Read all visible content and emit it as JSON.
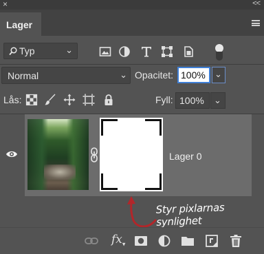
{
  "window": {
    "close_glyph": "×",
    "collapse_glyph": "<<"
  },
  "panel": {
    "tab_label": "Lager",
    "menu_icon": "panel-menu-icon"
  },
  "filter": {
    "kind_label": "Typ",
    "icons": [
      "image-filter-icon",
      "adjustment-filter-icon",
      "type-filter-icon",
      "shape-filter-icon",
      "smart-object-filter-icon"
    ]
  },
  "blend": {
    "mode": "Normal",
    "opacity_label": "Opacitet:",
    "opacity_value": "100%"
  },
  "lock": {
    "label": "Lås:",
    "icons": [
      "lock-transparent-pixels-icon",
      "lock-image-pixels-icon",
      "lock-position-icon",
      "lock-artboard-icon",
      "lock-all-icon"
    ],
    "fill_label": "Fyll:",
    "fill_value": "100%"
  },
  "layer": {
    "name": "Lager 0",
    "visible": true
  },
  "annotation": {
    "text": "Styr pixlarnas synlighet"
  },
  "footer": {
    "fx_label": "fx",
    "icons": [
      "link-layers-icon",
      "fx-icon",
      "add-mask-icon",
      "adjustment-layer-icon",
      "group-folder-icon",
      "new-layer-icon",
      "trash-icon"
    ]
  },
  "colors": {
    "panel_bg": "#535353",
    "accent": "#3f7fd6",
    "annotation_arrow": "#b2262a"
  }
}
